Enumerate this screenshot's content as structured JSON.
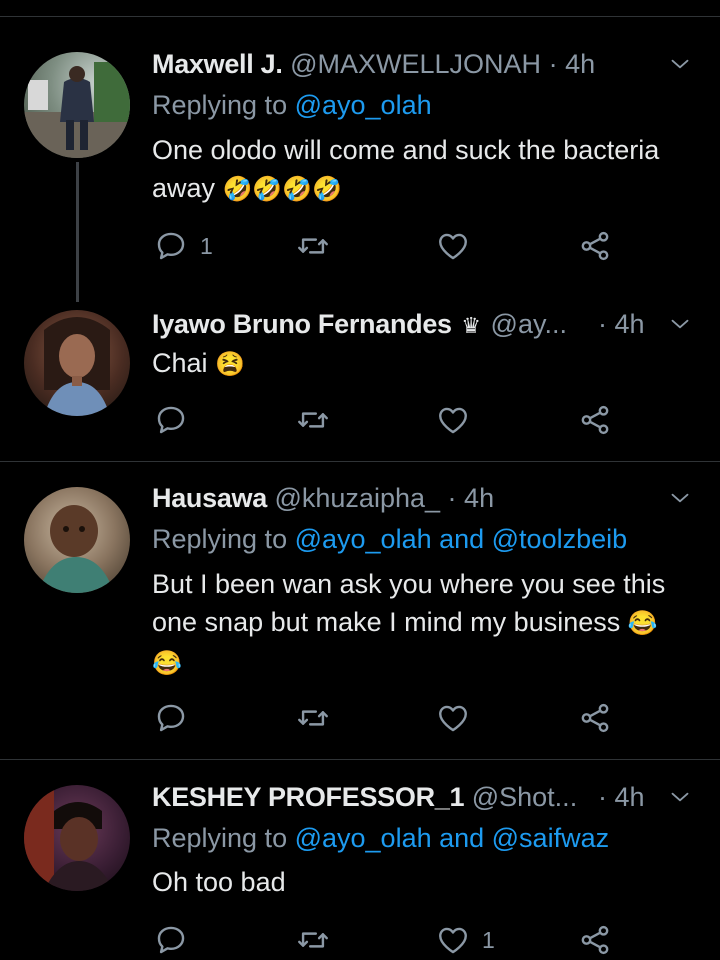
{
  "tweets": [
    {
      "name": "Maxwell J.",
      "handle": "@MAXWELLJONAH",
      "time": "4h",
      "replying_prefix": "Replying to ",
      "replying_to": "@ayo_olah",
      "text": "One olodo will come and suck the bacteria away",
      "emoji": "🤣🤣🤣🤣",
      "reply_count": "1",
      "like_count": ""
    },
    {
      "name": "Iyawo Bruno Fernandes",
      "badge": "♛",
      "handle": "@ay...",
      "time": "4h",
      "text": "Chai",
      "emoji": "😫",
      "reply_count": "",
      "like_count": ""
    },
    {
      "name": "Hausawa",
      "handle": "@khuzaipha_",
      "time": "4h",
      "replying_prefix": "Replying to ",
      "replying_to": "@ayo_olah and @toolzbeib",
      "text": "But I been wan ask you where you see this one snap but make I mind my business",
      "emoji": "😂😂",
      "reply_count": "",
      "like_count": ""
    },
    {
      "name": "KESHEY PROFESSOR_1",
      "handle": "@Shot...",
      "time": "4h",
      "replying_prefix": "Replying to ",
      "replying_to": "@ayo_olah and @saifwaz",
      "text": "Oh too bad",
      "reply_count": "",
      "like_count": "1"
    }
  ],
  "separator": "·",
  "icons": [
    "reply-icon",
    "retweet-icon",
    "like-icon",
    "share-icon",
    "chevron-down-icon"
  ],
  "colors": {
    "background": "#000000",
    "link": "#1d9bf0",
    "muted": "#8b98a5",
    "text": "#e7e9ea"
  }
}
